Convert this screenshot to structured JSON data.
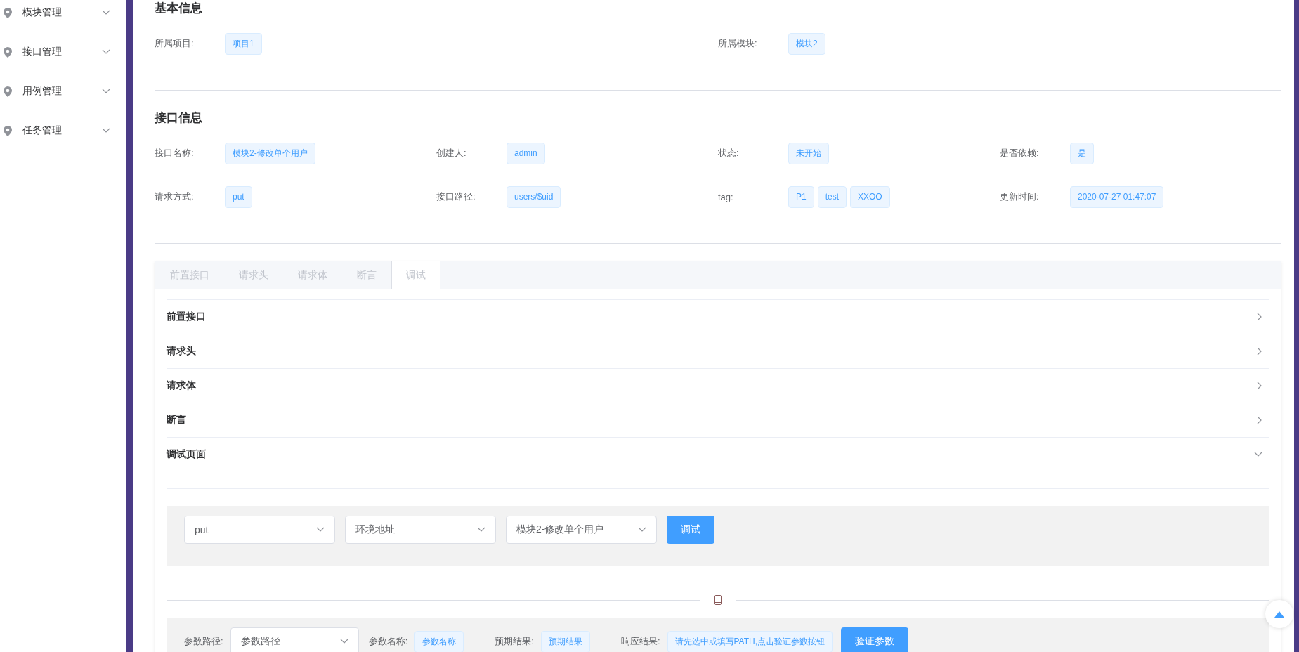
{
  "sidebar": {
    "items": [
      {
        "label": "模块管理",
        "expanded": false
      },
      {
        "label": "接口管理",
        "expanded": false
      },
      {
        "label": "用例管理",
        "expanded": false
      },
      {
        "label": "任务管理",
        "expanded": false
      }
    ]
  },
  "sections": [
    {
      "title": "基本信息",
      "fields": [
        {
          "label": "所属项目:",
          "tags": [
            "项目1"
          ]
        },
        {
          "label": "所属模块:",
          "tags": [
            "模块2"
          ]
        }
      ]
    },
    {
      "title": "接口信息",
      "fields": [
        {
          "label": "接口名称:",
          "tags": [
            "模块2-修改单个用户"
          ]
        },
        {
          "label": "创建人:",
          "tags": [
            "admin"
          ]
        },
        {
          "label": "状态:",
          "tags": [
            "未开始"
          ]
        },
        {
          "label": "是否依赖:",
          "tags": [
            "是"
          ]
        },
        {
          "label": "请求方式:",
          "tags": [
            "put"
          ]
        },
        {
          "label": "接口路径:",
          "tags": [
            "users/$uid"
          ]
        },
        {
          "label": "tag:",
          "tags": [
            "P1",
            "test",
            "XXOO"
          ]
        },
        {
          "label": "更新时间:",
          "tags": [
            "2020-07-27 01:47:07"
          ]
        }
      ]
    }
  ],
  "tabs": [
    {
      "label": "前置接口",
      "selected": false
    },
    {
      "label": "请求头",
      "selected": false
    },
    {
      "label": "请求体",
      "selected": false
    },
    {
      "label": "断言",
      "selected": false
    },
    {
      "label": "调试",
      "selected": true
    }
  ],
  "collapse": [
    {
      "title": "前置接口",
      "expanded": false
    },
    {
      "title": "请求头",
      "expanded": false
    },
    {
      "title": "请求体",
      "expanded": false
    },
    {
      "title": "断言",
      "expanded": false
    },
    {
      "title": "调试页面",
      "expanded": true
    }
  ],
  "debug_bar": {
    "selects": [
      {
        "value": "put"
      },
      {
        "value": "环境地址"
      },
      {
        "value": "模块2-修改单个用户"
      }
    ],
    "button": "调试"
  },
  "assert_bar": {
    "items": [
      {
        "kind": "select",
        "label": "参数路径:",
        "value": "参数路径"
      },
      {
        "kind": "tag",
        "label": "参数名称:",
        "value": "参数名称"
      },
      {
        "kind": "tag",
        "label": "预期结果:",
        "value": "预期结果"
      },
      {
        "kind": "tag",
        "label": "响应结果:",
        "value": "请先选中或填写PATH,点击验证参数按钮"
      }
    ],
    "button": "验证参数"
  }
}
